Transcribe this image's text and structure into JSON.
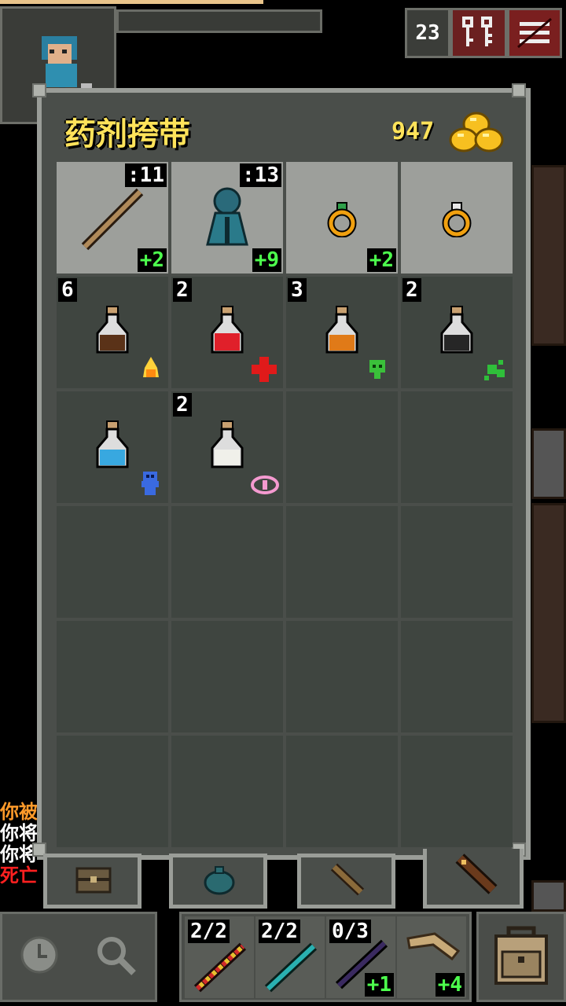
{
  "hud": {
    "depth": "23",
    "journal_icon": "keys-icon",
    "menu_icon": "menu-icon"
  },
  "log": {
    "lines": [
      {
        "text": "你被",
        "color": "#ff9a2a"
      },
      {
        "text": "你将",
        "color": "#ffffff"
      },
      {
        "text": "你将",
        "color": "#ffffff"
      },
      {
        "text": "死亡",
        "color": "#ff2020"
      }
    ]
  },
  "bag": {
    "title": "药剂挎带",
    "gold": "947",
    "equipped": [
      {
        "name": "staff",
        "charges": ":11",
        "level": "+2"
      },
      {
        "name": "cloak-armor",
        "charges": ":13",
        "level": "+9"
      },
      {
        "name": "ring-green",
        "charges": "",
        "level": "+2"
      },
      {
        "name": "ring-white",
        "charges": "",
        "level": ""
      }
    ],
    "potions": [
      {
        "name": "potion-brown",
        "qty": "6",
        "tag": "flame"
      },
      {
        "name": "potion-red",
        "qty": "2",
        "tag": "heal"
      },
      {
        "name": "potion-orange",
        "qty": "3",
        "tag": "toxic"
      },
      {
        "name": "potion-dark",
        "qty": "2",
        "tag": "splash"
      },
      {
        "name": "potion-cyan",
        "qty": "",
        "tag": "frost"
      },
      {
        "name": "potion-white",
        "qty": "2",
        "tag": "vision"
      }
    ]
  },
  "quickslots": [
    {
      "name": "wand-fire",
      "charges": "2/2",
      "level": ""
    },
    {
      "name": "wand-frost",
      "charges": "2/2",
      "level": ""
    },
    {
      "name": "wand-dark",
      "charges": "0/3",
      "level": "+1"
    },
    {
      "name": "boomerang",
      "charges": "",
      "level": "+4"
    }
  ],
  "colors": {
    "gold_text": "#ffe35a",
    "upgrade_text": "#4dff4d",
    "window_border": "#9a9d98"
  }
}
